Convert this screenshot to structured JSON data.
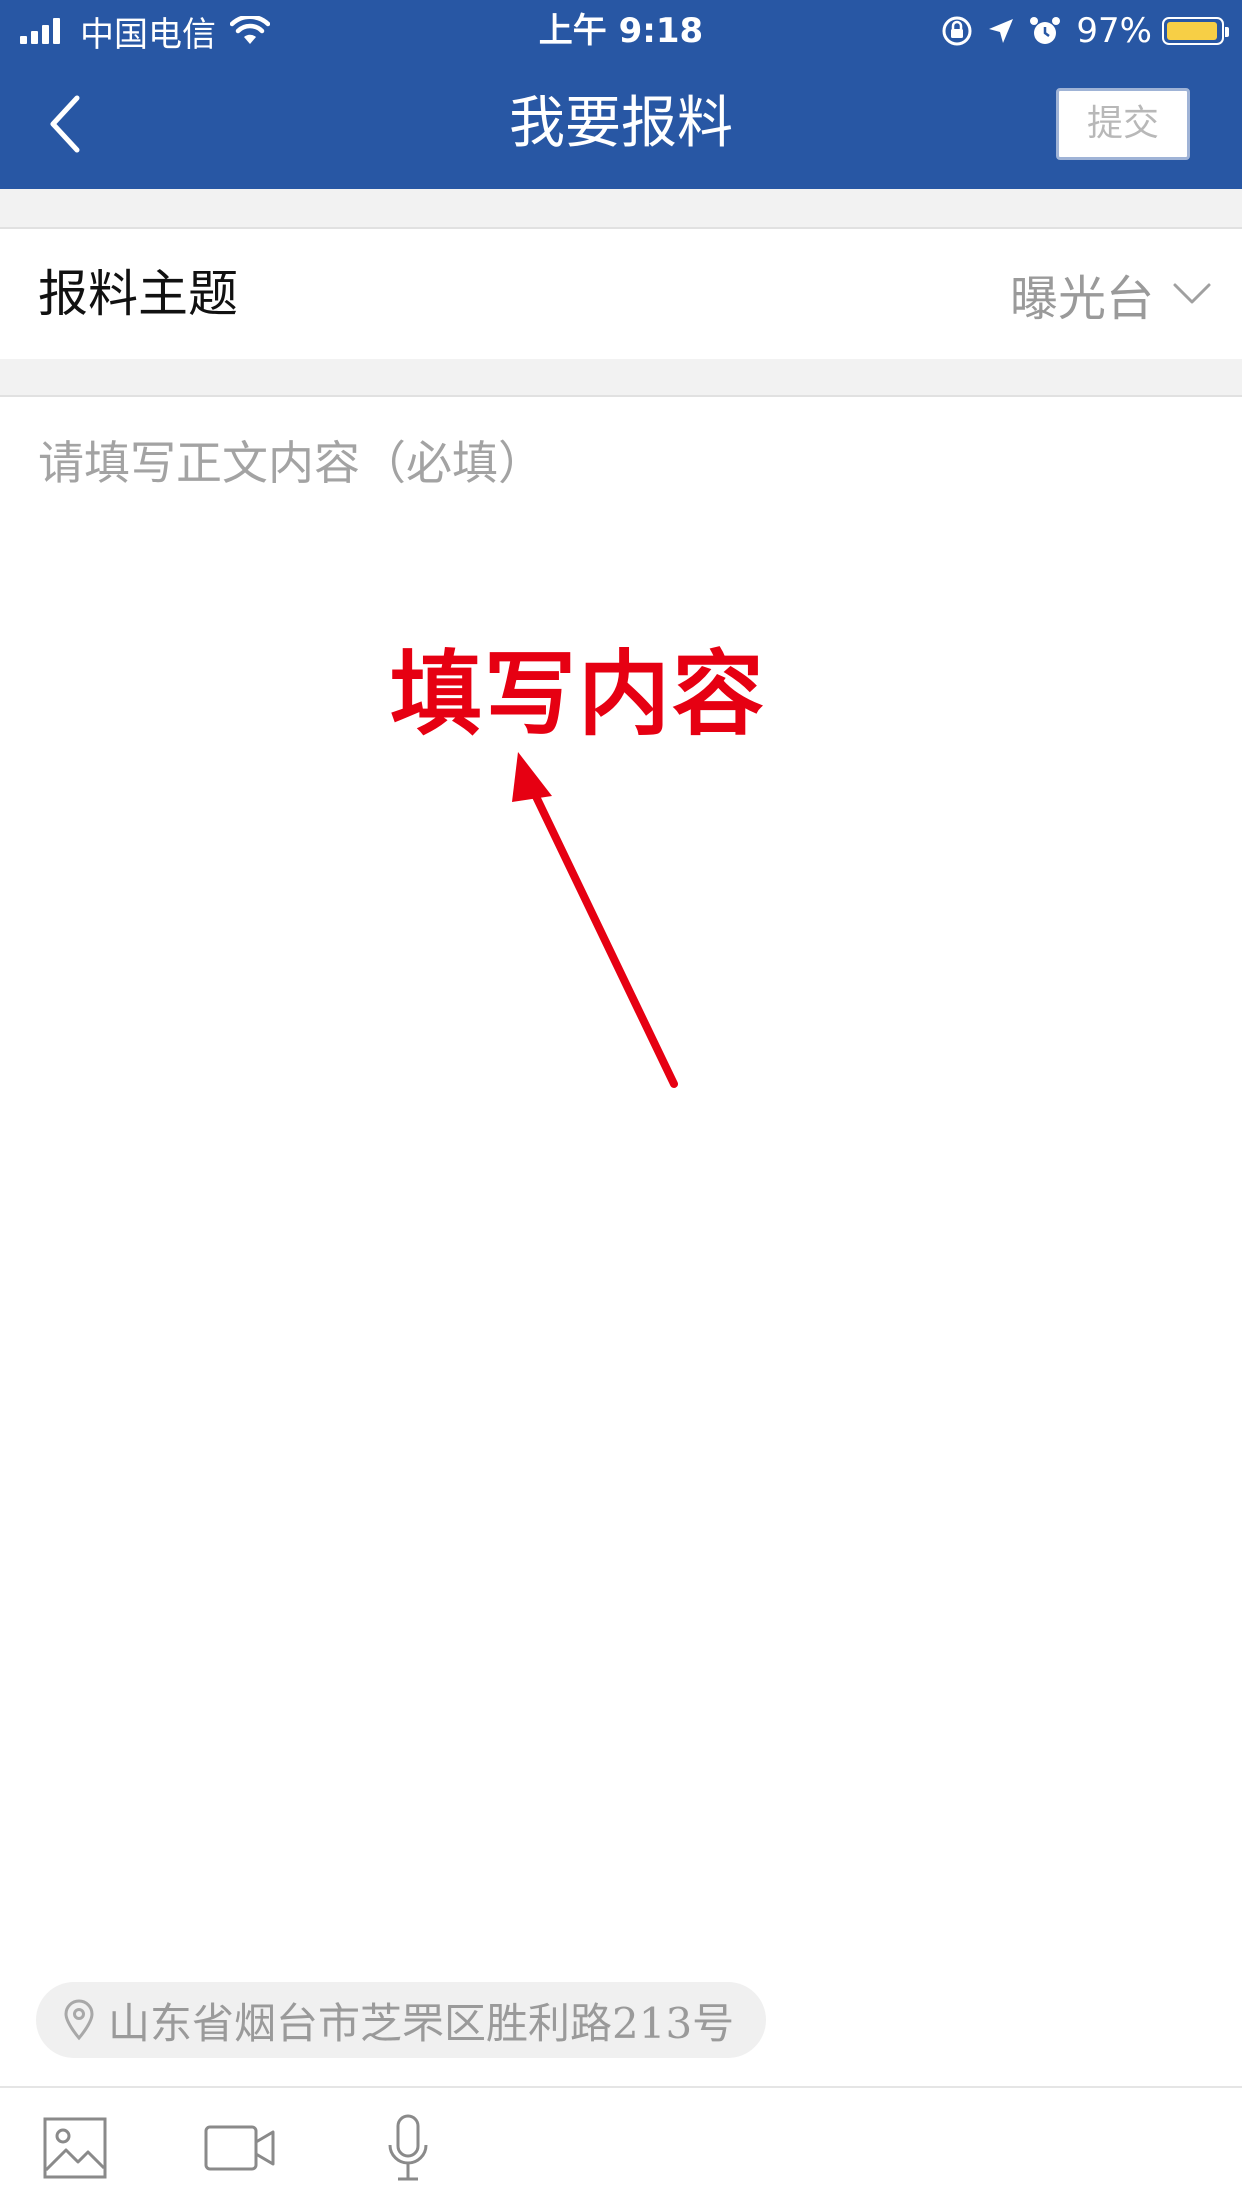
{
  "status_bar": {
    "carrier": "中国电信",
    "time": "上午 9:18",
    "battery_percent": "97%",
    "battery_level": 0.97,
    "battery_color": "#f7cf45",
    "icons": [
      "signal-icon",
      "wifi-icon",
      "orientation-lock-icon",
      "location-icon",
      "alarm-icon",
      "battery-icon"
    ]
  },
  "nav": {
    "title": "我要报料",
    "submit_label": "提交",
    "back_icon": "chevron-left-icon",
    "header_color": "#2857a4"
  },
  "topic": {
    "label": "报料主题",
    "value": "曝光台",
    "dropdown_icon": "chevron-down-icon"
  },
  "content": {
    "placeholder": "请填写正文内容（必填）",
    "value": ""
  },
  "annotation": {
    "text": "填写内容",
    "color": "#e60012"
  },
  "location": {
    "text": "山东省烟台市芝罘区胜利路213号",
    "icon": "location-pin-icon"
  },
  "toolbar": {
    "items": [
      {
        "icon": "image-icon"
      },
      {
        "icon": "video-camera-icon"
      },
      {
        "icon": "microphone-icon"
      }
    ]
  }
}
